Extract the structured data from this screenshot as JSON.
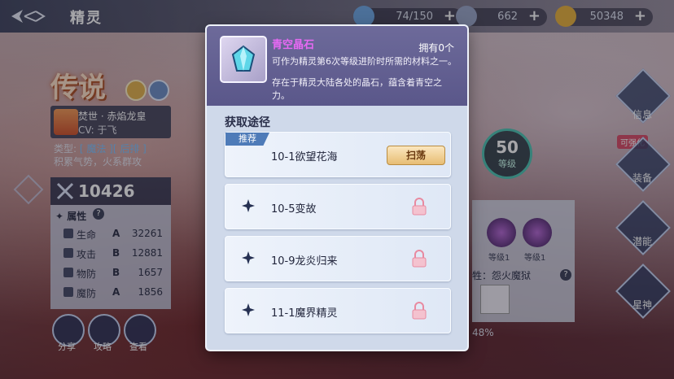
{
  "header": {
    "title": "精灵",
    "resources": [
      {
        "name": "stamina",
        "value": "74/150"
      },
      {
        "name": "diamond",
        "value": "662"
      },
      {
        "name": "coin",
        "value": "50348"
      }
    ]
  },
  "spirit": {
    "rarity": "传说",
    "name": "焚世 · 赤焰龙皇",
    "cv": "CV: 于飞",
    "type_prefix": "类型: ",
    "type_tag1": "[ 魔法 ]",
    "type_tag2": "[ 后排 ]",
    "skill_desc": "积累气势，火系群攻",
    "power": "10426",
    "attr_title": "属性",
    "attrs": [
      {
        "name": "生命",
        "grade": "A",
        "value": "32261"
      },
      {
        "name": "攻击",
        "grade": "B",
        "value": "12881"
      },
      {
        "name": "物防",
        "grade": "B",
        "value": "1657"
      },
      {
        "name": "魔防",
        "grade": "A",
        "value": "1856"
      }
    ]
  },
  "bottom_buttons": [
    "分享",
    "攻略",
    "查看"
  ],
  "right_menu": {
    "info": "信息",
    "upgradable": "可强化",
    "equip": "装备",
    "potential": "潜能",
    "star_god": "星神"
  },
  "level": {
    "value": "50",
    "label": "等级"
  },
  "skills": {
    "levels": [
      "等级1",
      "等级1"
    ]
  },
  "bond": {
    "label": "牲：怨火魔狱",
    "percent": "48%"
  },
  "popup": {
    "item_name": "青空晶石",
    "own": "拥有0个",
    "desc1": "可作为精灵第6次等级进阶时所需的材料之一。",
    "desc2": "存在于精灵大陆各处的晶石，蕴含着青空之力。",
    "source_title": "获取途径",
    "recommend": "推荐",
    "sweep_label": "扫荡",
    "sources": [
      {
        "label": "10-1欲望花海",
        "locked": false
      },
      {
        "label": "10-5变故",
        "locked": true
      },
      {
        "label": "10-9龙炎归来",
        "locked": true
      },
      {
        "label": "11-1魔界精灵",
        "locked": true
      }
    ]
  },
  "colors": {
    "item_name": "#e869f4",
    "popup_head": "#5a578a",
    "popup_body": "#cfd9ea",
    "recommend_badge": "#4e7bb8",
    "sweep_button": "#e7bd74"
  }
}
